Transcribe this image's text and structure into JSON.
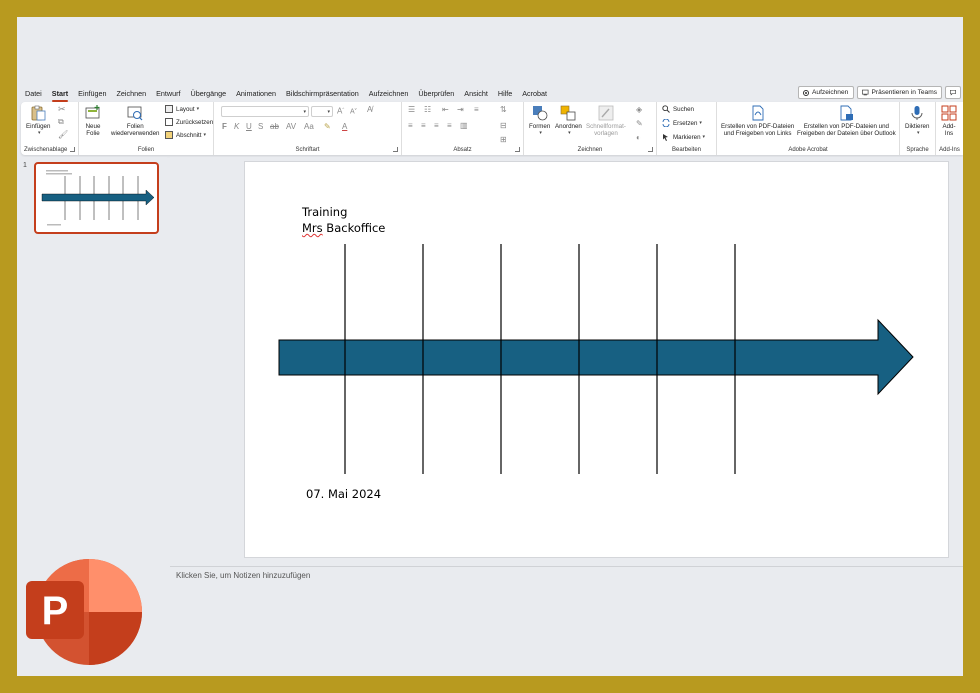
{
  "menu": {
    "tabs": [
      "Datei",
      "Start",
      "Einfügen",
      "Zeichnen",
      "Entwurf",
      "Übergänge",
      "Animationen",
      "Bildschirmpräsentation",
      "Aufzeichnen",
      "Überprüfen",
      "Ansicht",
      "Hilfe",
      "Acrobat"
    ],
    "active_tab": "Start",
    "record_label": "Aufzeichnen",
    "teams_label": "Präsentieren in Teams"
  },
  "ribbon": {
    "clipboard": {
      "paste": "Einfügen",
      "label": "Zwischenablage"
    },
    "slides": {
      "new_slide_line1": "Neue",
      "new_slide_line2": "Folie",
      "reuse_line1": "Folien",
      "reuse_line2": "wiederverwenden",
      "layout": "Layout",
      "reset": "Zurücksetzen",
      "section": "Abschnitt",
      "label": "Folien"
    },
    "font": {
      "label": "Schriftart"
    },
    "paragraph": {
      "label": "Absatz"
    },
    "drawing": {
      "shapes": "Formen",
      "arrange": "Anordnen",
      "quick_styles_line1": "Schnellformat-",
      "quick_styles_line2": "vorlagen",
      "label": "Zeichnen"
    },
    "editing": {
      "find": "Suchen",
      "replace": "Ersetzen",
      "select": "Markieren",
      "label": "Bearbeiten"
    },
    "acrobat": {
      "create_pdf_line1": "Erstellen von PDF-Dateien",
      "create_pdf_line2": "und Freigeben von Links",
      "create_outlook_line1": "Erstellen von PDF-Dateien und",
      "create_outlook_line2": "Freigeben der Dateien über Outlook",
      "label": "Adobe Acrobat"
    },
    "voice": {
      "dictate": "Diktieren",
      "label": "Sprache"
    },
    "addins": {
      "addins_line1": "Add-",
      "addins_line2": "Ins",
      "label": "Add-Ins"
    }
  },
  "thumbnail": {
    "number": "1"
  },
  "slide": {
    "title_line1": "Training",
    "title_line2_part1": "Mrs",
    "title_line2_part2": " Backoffice",
    "date": "07. Mai 2024",
    "arrow_color": "#176082"
  },
  "notes": {
    "placeholder": "Klicken Sie, um Notizen hinzuzufügen"
  },
  "colors": {
    "accent": "#c43e1c",
    "frame": "#b89a1f"
  },
  "icons": [
    "paste-icon",
    "new-slide-icon",
    "reuse-slides-icon",
    "shapes-icon",
    "arrange-icon",
    "search-icon",
    "replace-icon",
    "select-icon",
    "pdf-icon",
    "microphone-icon",
    "addins-icon",
    "powerpoint-logo"
  ]
}
